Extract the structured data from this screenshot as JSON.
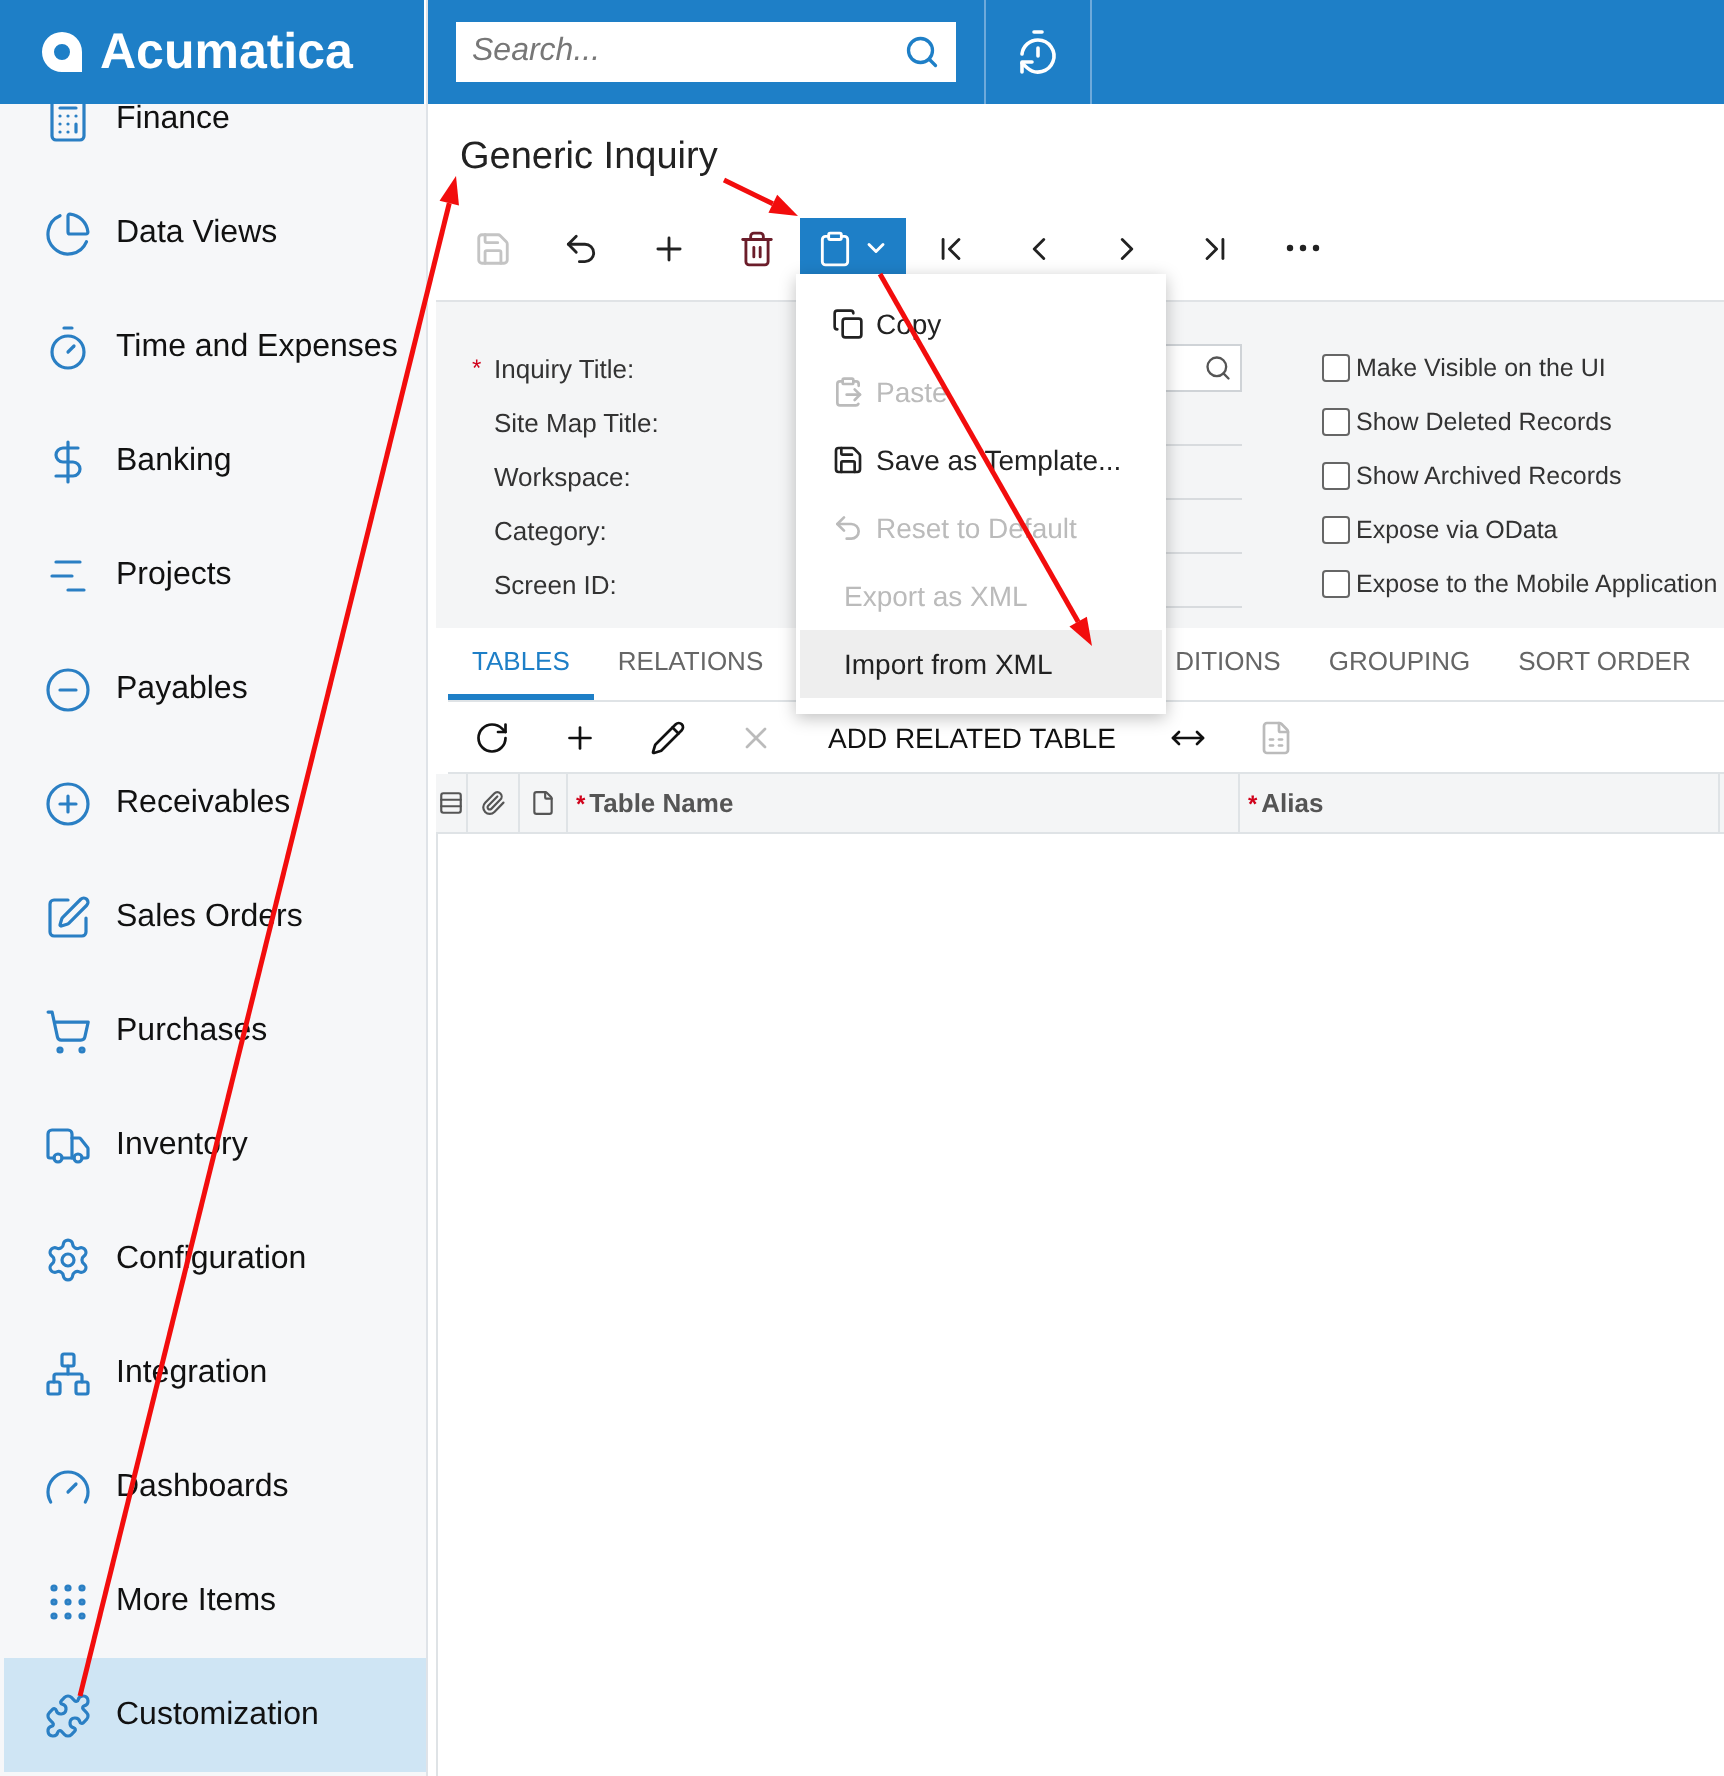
{
  "logo": {
    "text": "Acumatica"
  },
  "search": {
    "placeholder": "Search..."
  },
  "sidebar": {
    "items": [
      {
        "label": "Finance",
        "selected": false
      },
      {
        "label": "Data Views",
        "selected": false
      },
      {
        "label": "Time and Expenses",
        "selected": false
      },
      {
        "label": "Banking",
        "selected": false
      },
      {
        "label": "Projects",
        "selected": false
      },
      {
        "label": "Payables",
        "selected": false
      },
      {
        "label": "Receivables",
        "selected": false
      },
      {
        "label": "Sales Orders",
        "selected": false
      },
      {
        "label": "Purchases",
        "selected": false
      },
      {
        "label": "Inventory",
        "selected": false
      },
      {
        "label": "Configuration",
        "selected": false
      },
      {
        "label": "Integration",
        "selected": false
      },
      {
        "label": "Dashboards",
        "selected": false
      },
      {
        "label": "More Items",
        "selected": false
      },
      {
        "label": "Customization",
        "selected": true
      }
    ]
  },
  "page": {
    "title": "Generic Inquiry"
  },
  "toolbar": [
    {
      "kind": "save",
      "disabled": true,
      "selected": false
    },
    {
      "kind": "undo",
      "disabled": false,
      "selected": false
    },
    {
      "kind": "add",
      "disabled": false,
      "selected": false
    },
    {
      "kind": "delete",
      "disabled": false,
      "selected": false
    },
    {
      "kind": "clipboard",
      "disabled": false,
      "selected": true
    },
    {
      "kind": "first",
      "disabled": false,
      "selected": false
    },
    {
      "kind": "prev",
      "disabled": false,
      "selected": false
    },
    {
      "kind": "next",
      "disabled": false,
      "selected": false
    },
    {
      "kind": "last",
      "disabled": false,
      "selected": false
    },
    {
      "kind": "more",
      "disabled": false,
      "selected": false
    }
  ],
  "menu": [
    {
      "kind": "copy",
      "label": "Copy",
      "disabled": false,
      "highlighted": false
    },
    {
      "kind": "paste",
      "label": "Paste",
      "disabled": true,
      "highlighted": false
    },
    {
      "kind": "save",
      "label": "Save as Template...",
      "disabled": false,
      "highlighted": false
    },
    {
      "kind": "reset",
      "label": "Reset to Default",
      "disabled": true,
      "highlighted": false
    },
    {
      "kind": "plain",
      "label": "Export as XML",
      "disabled": true,
      "highlighted": false
    },
    {
      "kind": "plain",
      "label": "Import from XML",
      "disabled": false,
      "highlighted": true
    }
  ],
  "form": {
    "fields": [
      {
        "label": "Inquiry Title:",
        "mark": "*",
        "kind": "lookup"
      },
      {
        "label": "Site Map Title:",
        "kind": "text"
      },
      {
        "label": "Workspace:",
        "kind": "text"
      },
      {
        "label": "Category:",
        "kind": "text"
      },
      {
        "label": "Screen ID:",
        "kind": "text"
      }
    ],
    "checkboxes": [
      {
        "label": "Make Visible on the UI",
        "checked": false
      },
      {
        "label": "Show Deleted Records",
        "checked": false
      },
      {
        "label": "Show Archived Records",
        "checked": false
      },
      {
        "label": "Expose via OData",
        "checked": false
      },
      {
        "label": "Expose to the Mobile Application",
        "checked": false
      }
    ]
  },
  "tabs": [
    {
      "label": "TABLES",
      "selected": true
    },
    {
      "label": "RELATIONS",
      "selected": false
    },
    {
      "label": "DITIONS",
      "selected": false
    },
    {
      "label": "GROUPING",
      "selected": false
    },
    {
      "label": "SORT ORDER",
      "selected": false
    }
  ],
  "grid_toolbar": [
    {
      "kind": "refresh",
      "disabled": false
    },
    {
      "kind": "add",
      "disabled": false
    },
    {
      "kind": "edit",
      "disabled": false
    },
    {
      "kind": "delete",
      "disabled": true
    },
    {
      "kind": "text",
      "label": "ADD RELATED TABLE",
      "disabled": false
    },
    {
      "kind": "fit",
      "disabled": false
    },
    {
      "kind": "excel",
      "disabled": true
    }
  ],
  "table": {
    "columns": [
      {
        "kind": "icon"
      },
      {
        "kind": "icon"
      },
      {
        "kind": "icon"
      },
      {
        "kind": "text",
        "label": "Table Name",
        "mark": "*"
      },
      {
        "kind": "text",
        "label": "Alias",
        "mark": "*"
      }
    ]
  }
}
